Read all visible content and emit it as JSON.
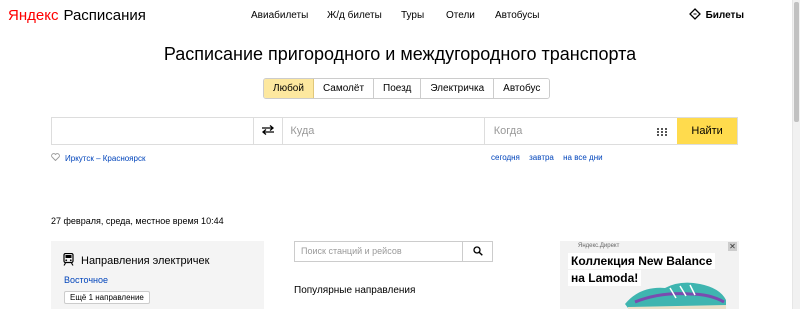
{
  "header": {
    "logo_brand": "Яндекс",
    "logo_service": "Расписания",
    "nav": [
      "Авиабилеты",
      "Ж/д билеты",
      "Туры",
      "Отели",
      "Автобусы"
    ],
    "tickets_label": "Билеты"
  },
  "main": {
    "title": "Расписание пригородного и междугородного транспорта",
    "tabs": [
      {
        "label": "Любой",
        "active": true
      },
      {
        "label": "Самолёт",
        "active": false
      },
      {
        "label": "Поезд",
        "active": false
      },
      {
        "label": "Электричка",
        "active": false
      },
      {
        "label": "Автобус",
        "active": false
      }
    ],
    "search": {
      "from_value": "",
      "to_placeholder": "Куда",
      "when_placeholder": "Когда",
      "submit_label": "Найти"
    },
    "recent_route": "Иркутск – Красноярск",
    "date_shortcuts": [
      "сегодня",
      "завтра",
      "на все дни"
    ],
    "dateline": "27 февраля, среда, местное время 10:44"
  },
  "card": {
    "title": "Направления электричек",
    "direction": "Восточное",
    "more_button": "Ещё 1 направление"
  },
  "stations": {
    "search_placeholder": "Поиск станций и рейсов",
    "popular_heading": "Популярные направления"
  },
  "ad": {
    "label": "Яндекс.Директ",
    "close": "✕",
    "line1": "Коллекция New Balance",
    "line2": "на Lamoda!"
  },
  "colors": {
    "accent_yellow": "#ffdb4d",
    "active_tab": "#fde89f",
    "link_blue": "#0044bb",
    "brand_red": "#ff0000"
  }
}
